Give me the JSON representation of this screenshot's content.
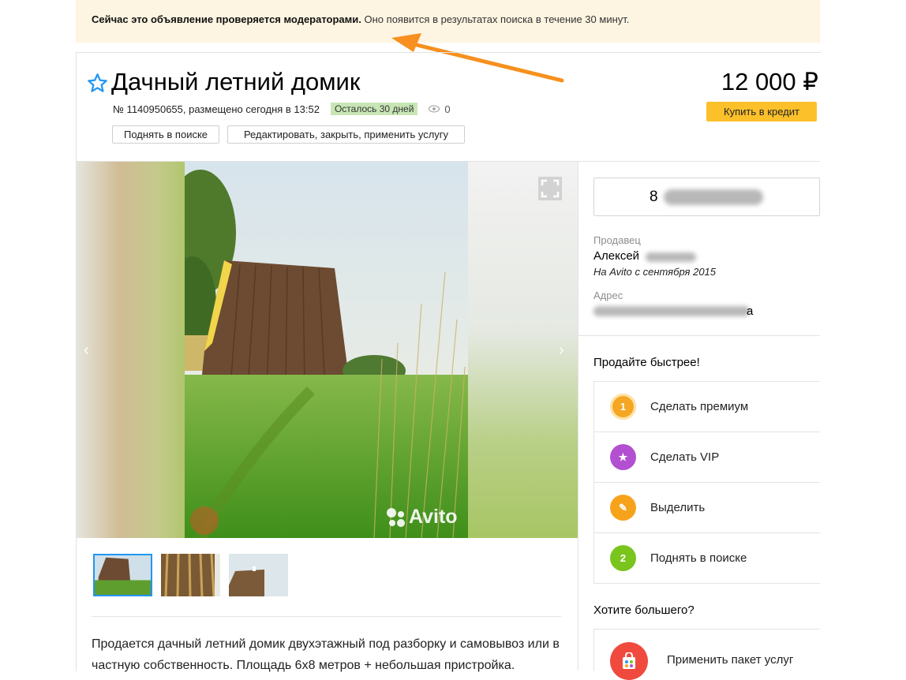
{
  "notice": {
    "bold": "Сейчас это объявление проверяется модераторами.",
    "rest": "Оно появится в результатах поиска в течение 30 минут."
  },
  "listing": {
    "title": "Дачный летний домик",
    "meta": "№ 1140950655, размещено сегодня в 13:52",
    "badge": "Осталось 30 дней",
    "views": "0",
    "price": "12 000 ₽",
    "credit_button": "Купить в кредит",
    "raise_button": "Поднять в поиске",
    "edit_button": "Редактировать, закрыть, применить услугу",
    "watermark": "Avito",
    "description": "Продается дачный летний домик двухэтажный под разборку и самовывоз или в частную собственность. Площадь 6х8 метров + небольшая пристройка."
  },
  "contact": {
    "phone_prefix": "8",
    "seller_label": "Продавец",
    "seller_name": "Алексей",
    "since": "На Avito с сентября 2015",
    "address_label": "Адрес",
    "address_tail": "а"
  },
  "promo": {
    "title": "Продайте быстрее!",
    "items": [
      {
        "label": "Сделать премиум",
        "color": "#f5a623",
        "icon": "1"
      },
      {
        "label": "Сделать VIP",
        "color": "#b34fd1",
        "icon": "★"
      },
      {
        "label": "Выделить",
        "color": "#f7a21b",
        "icon": "✎"
      },
      {
        "label": "Поднять в поиске",
        "color": "#7ac41e",
        "icon": "2"
      }
    ],
    "more_title": "Хотите большего?",
    "package_label": "Применить пакет услуг",
    "package_color": "#f04a3e"
  },
  "colors": {
    "accent_star": "#2196f3",
    "credit_bg": "#fcc02b",
    "banner_bg": "#fdf4e1",
    "arrow": "#f7901e"
  }
}
